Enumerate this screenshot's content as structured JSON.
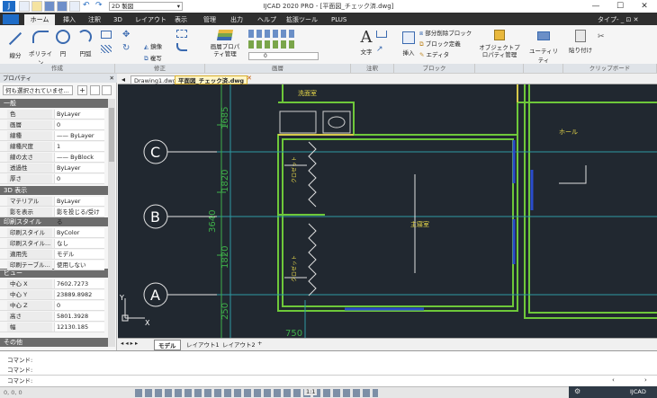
{
  "title_bar": {
    "title": "IJCAD 2020 PRO - [平面図_チェック済.dwg]",
    "workspace": "2D 製図",
    "window_controls": [
      "—",
      "☐",
      "✕"
    ]
  },
  "menu": {
    "tabs": [
      "ホーム",
      "挿入",
      "注釈",
      "3D",
      "レイアウト",
      "表示",
      "管理",
      "出力",
      "ヘルプ",
      "拡張ツール",
      "PLUS"
    ],
    "active": "ホーム",
    "right_label": "タイプ- _ ⊡ ✕"
  },
  "ribbon": {
    "tools": {
      "line": "線分",
      "polyline": "ポリライン",
      "circle": "円",
      "arc": "円弧",
      "mirror": "鏡像",
      "copy": "複写",
      "layer_props": "画層プロパティ管理",
      "layer_value": "0",
      "text": "文字",
      "insert": "挿入",
      "partial_delete_block": "部分削除ブロック",
      "block_define": "ブロック定義",
      "editor": "エディタ",
      "object_props": "オブジェクトプロパティ管理",
      "utility": "ユーティリティ",
      "paste": "貼り付け"
    },
    "groups": [
      "作成",
      "修正",
      "画層",
      "注釈",
      "ブロック",
      "",
      "",
      "クリップボード"
    ]
  },
  "properties": {
    "header": "プロパティ",
    "selection": "何も選択されていませ...",
    "sections": {
      "general": "一般",
      "view3d": "3D 表示",
      "plot": "印刷スタイル",
      "view": "ビュー",
      "misc": "その他"
    },
    "general_rows": [
      {
        "k": "色",
        "v": "ByLayer"
      },
      {
        "k": "画層",
        "v": "0"
      },
      {
        "k": "線種",
        "v": "—— ByLayer"
      },
      {
        "k": "線種尺度",
        "v": "1"
      },
      {
        "k": "線の太さ",
        "v": "—— ByBlock"
      },
      {
        "k": "透過性",
        "v": "ByLayer"
      },
      {
        "k": "厚さ",
        "v": "0"
      }
    ],
    "view3d_rows": [
      {
        "k": "マテリアル",
        "v": "ByLayer"
      },
      {
        "k": "影を表示",
        "v": "影を投じる/受ける"
      }
    ],
    "plot_rows": [
      {
        "k": "印刷スタイル",
        "v": "ByColor"
      },
      {
        "k": "印刷スタイル...",
        "v": "なし"
      },
      {
        "k": "適用先",
        "v": "モデル"
      },
      {
        "k": "印刷テーブル...",
        "v": "使用しない"
      }
    ],
    "view_rows": [
      {
        "k": "中心 X",
        "v": "7602.7273"
      },
      {
        "k": "中心 Y",
        "v": "23889.8982"
      },
      {
        "k": "中心 Z",
        "v": "0"
      },
      {
        "k": "高さ",
        "v": "5801.3928"
      },
      {
        "k": "幅",
        "v": "12130.185"
      }
    ]
  },
  "doc_tabs": [
    "Drawing1.dwg",
    "平面図_チェック済.dwg"
  ],
  "drawing": {
    "rooms": {
      "wash": "洗面室",
      "hall": "ホール",
      "master": "主寝室",
      "closet": "クロゼット"
    },
    "grid": [
      "C",
      "B",
      "A"
    ],
    "dims": [
      "1685",
      "1820",
      "3640",
      "1820",
      "250",
      "750"
    ],
    "ucs_y": "Y",
    "ucs_x": "X"
  },
  "layout_tabs": [
    "モデル",
    "レイアウト1",
    "レイアウト2",
    "+"
  ],
  "command": {
    "lines": [
      "コマンド:",
      "コマンド:",
      "コマンド:"
    ]
  },
  "status": {
    "coords": "0, 0, 0",
    "scale": "1:1",
    "product": "IJCAD"
  }
}
